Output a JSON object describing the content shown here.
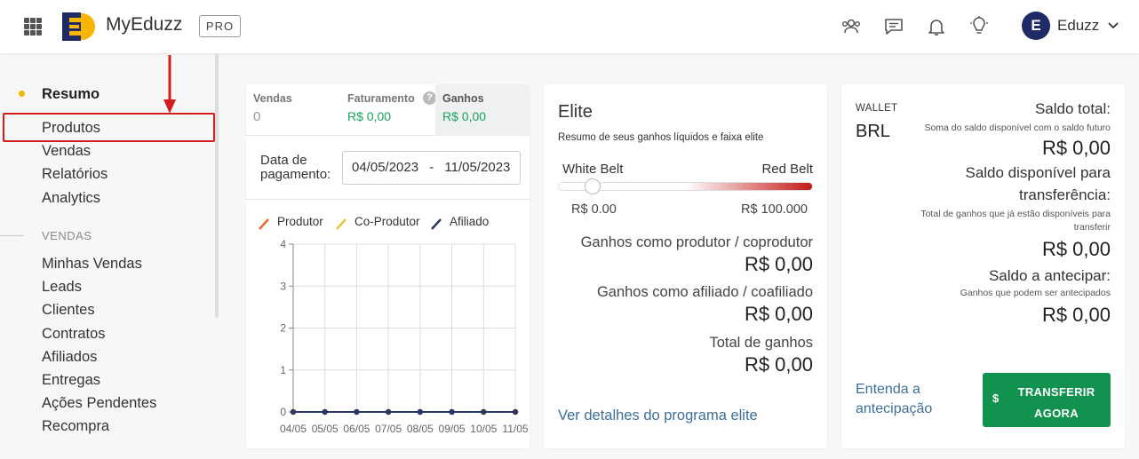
{
  "header": {
    "brand": "MyEduzz",
    "badge": "PRO",
    "user_initial": "E",
    "user_name": "Eduzz",
    "icons": [
      "apps-grid-icon",
      "eduzz-logo",
      "users-icon",
      "chat-icon",
      "bell-icon",
      "lightbulb-icon",
      "chevron-down-icon"
    ]
  },
  "sidebar": {
    "items": [
      {
        "label": "Resumo",
        "active": true
      },
      {
        "label": "Produtos",
        "highlighted": true
      },
      {
        "label": "Vendas"
      },
      {
        "label": "Relatórios"
      },
      {
        "label": "Analytics"
      }
    ],
    "section_title": "VENDAS",
    "section_items": [
      "Minhas Vendas",
      "Leads",
      "Clientes",
      "Contratos",
      "Afiliados",
      "Entregas",
      "Ações Pendentes",
      "Recompra"
    ]
  },
  "summary": {
    "tabs": [
      {
        "label": "Vendas",
        "value": "0"
      },
      {
        "label": "Faturamento",
        "value": "R$ 0,00"
      },
      {
        "label": "Ganhos",
        "value": "R$ 0,00",
        "active": true
      }
    ],
    "help": "?",
    "date_label": "Data de pagamento:",
    "date_start": "04/05/2023",
    "date_sep": "-",
    "date_end": "11/05/2023",
    "colors": {
      "produtor": "#e8692d",
      "coprodutor": "#f2c230",
      "afiliado": "#2b3566",
      "positive": "#1aa35a"
    }
  },
  "chart_data": {
    "type": "line",
    "categories": [
      "04/05",
      "05/05",
      "06/05",
      "07/05",
      "08/05",
      "09/05",
      "10/05",
      "11/05"
    ],
    "series": [
      {
        "name": "Produtor",
        "values": [
          0,
          0,
          0,
          0,
          0,
          0,
          0,
          0
        ]
      },
      {
        "name": "Co-Produtor",
        "values": [
          0,
          0,
          0,
          0,
          0,
          0,
          0,
          0
        ]
      },
      {
        "name": "Afiliado",
        "values": [
          0,
          0,
          0,
          0,
          0,
          0,
          0,
          0
        ]
      }
    ],
    "yticks": [
      "0",
      "1",
      "2",
      "3",
      "4"
    ],
    "ylim": [
      0,
      4
    ],
    "grid": true,
    "legend": "top-left"
  },
  "elite": {
    "title": "Elite",
    "subtitle": "Resumo de seus ganhos líquidos e faixa elite",
    "belt_start_label": "White Belt",
    "belt_end_label": "Red Belt",
    "belt_start_value": "R$ 0.00",
    "belt_end_value": "R$ 100.000",
    "belt_progress": 0.0,
    "producer_label": "Ganhos como produtor / coprodutor",
    "producer_value": "R$ 0,00",
    "affiliate_label": "Ganhos como afiliado / coafiliado",
    "affiliate_value": "R$ 0,00",
    "total_label": "Total de ganhos",
    "total_value": "R$ 0,00",
    "link": "Ver detalhes do programa elite"
  },
  "wallet": {
    "label": "WALLET",
    "currency": "BRL",
    "total_title": "Saldo total:",
    "total_note": "Soma do saldo disponível com o saldo futuro",
    "total_value": "R$ 0,00",
    "available_title_1": "Saldo disponível para",
    "available_title_2": "transferência:",
    "available_note_1": "Total de ganhos que já estão disponíveis para",
    "available_note_2": "transferir",
    "available_value": "R$ 0,00",
    "anticipate_title": "Saldo a antecipar:",
    "anticipate_note": "Ganhos que podem ser antecipados",
    "anticipate_value": "R$ 0,00",
    "link": "Entenda a antecipação",
    "button_symbol": "$",
    "button_label": "TRANSFERIR AGORA"
  }
}
